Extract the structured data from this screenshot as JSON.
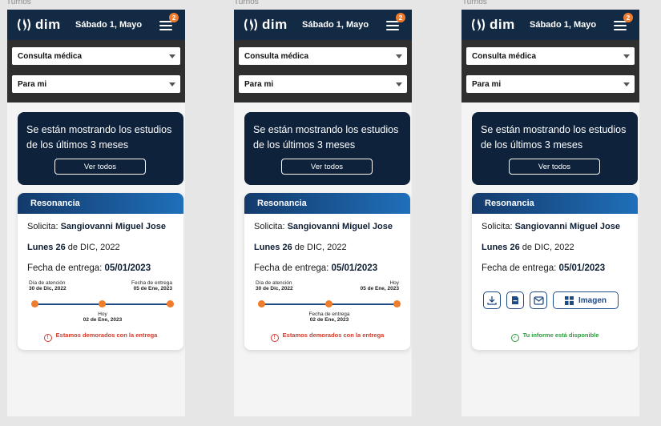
{
  "frames": [
    {
      "label": "Turnos",
      "header": {
        "logo": "dim",
        "date": "Sábado 1, Mayo",
        "badge": "2"
      },
      "selects": {
        "service": "Consulta médica",
        "patient": "Para mi"
      },
      "banner": {
        "text": "Se están mostrando los estudios de los últimos 3 meses",
        "button": "Ver todos"
      },
      "card": {
        "title": "Resonancia",
        "requester_label": "Solicita:",
        "requester": "Sangiovanni Miguel Jose",
        "day_bold": "Lunes 26",
        "day_rest": " de DIC, 2022",
        "delivery_label": "Fecha de entrega:",
        "delivery_date": "05/01/2023",
        "timeline": {
          "start_label": "Día de atención",
          "start_date": "30 de Dic, 2022",
          "end_label": "Fecha de entrega",
          "end_date": "05 de Ene, 2023",
          "mid_label": "Hoy",
          "mid_date": "02 de Ene, 2023"
        },
        "status": "Estamos demorados con la entrega"
      }
    },
    {
      "label": "Turnos",
      "header": {
        "logo": "dim",
        "date": "Sábado 1, Mayo",
        "badge": "2"
      },
      "selects": {
        "service": "Consulta médica",
        "patient": "Para mi"
      },
      "banner": {
        "text": "Se están mostrando los estudios de los últimos 3 meses",
        "button": "Ver todos"
      },
      "card": {
        "title": "Resonancia",
        "requester_label": "Solicita:",
        "requester": "Sangiovanni Miguel Jose",
        "day_bold": "Lunes 26",
        "day_rest": " de DIC, 2022",
        "delivery_label": "Fecha de entrega:",
        "delivery_date": "05/01/2023",
        "timeline": {
          "start_label": "Día de atención",
          "start_date": "30 de Dic, 2022",
          "end_label": "Hoy",
          "end_date": "05 de Ene, 2023",
          "mid_label": "Fecha de entrega",
          "mid_date": "02 de Ene, 2023"
        },
        "status": "Estamos demorados con la entrega"
      }
    },
    {
      "label": "Turnos",
      "header": {
        "logo": "dim",
        "date": "Sábado 1, Mayo",
        "badge": "2"
      },
      "selects": {
        "service": "Consulta médica",
        "patient": "Para mi"
      },
      "banner": {
        "text": "Se están mostrando los estudios de los últimos 3 meses",
        "button": "Ver todos"
      },
      "card": {
        "title": "Resonancia",
        "requester_label": "Solicita:",
        "requester": "Sangiovanni Miguel Jose",
        "day_bold": "Lunes 26",
        "day_rest": " de DIC, 2022",
        "delivery_label": "Fecha de entrega:",
        "delivery_date": "05/01/2023",
        "actions": {
          "download_icon": "download-icon",
          "pdf_icon": "pdf-icon",
          "email_icon": "email-icon",
          "image_label": "Imagen"
        },
        "status": "Tu informe está disponible"
      }
    }
  ],
  "colors": {
    "navy": "#132a44",
    "banner": "#0e223b",
    "accent": "#ef7d2d",
    "blue": "#1e4a86",
    "warn": "#d03a2a",
    "ok": "#2b9a3b"
  }
}
